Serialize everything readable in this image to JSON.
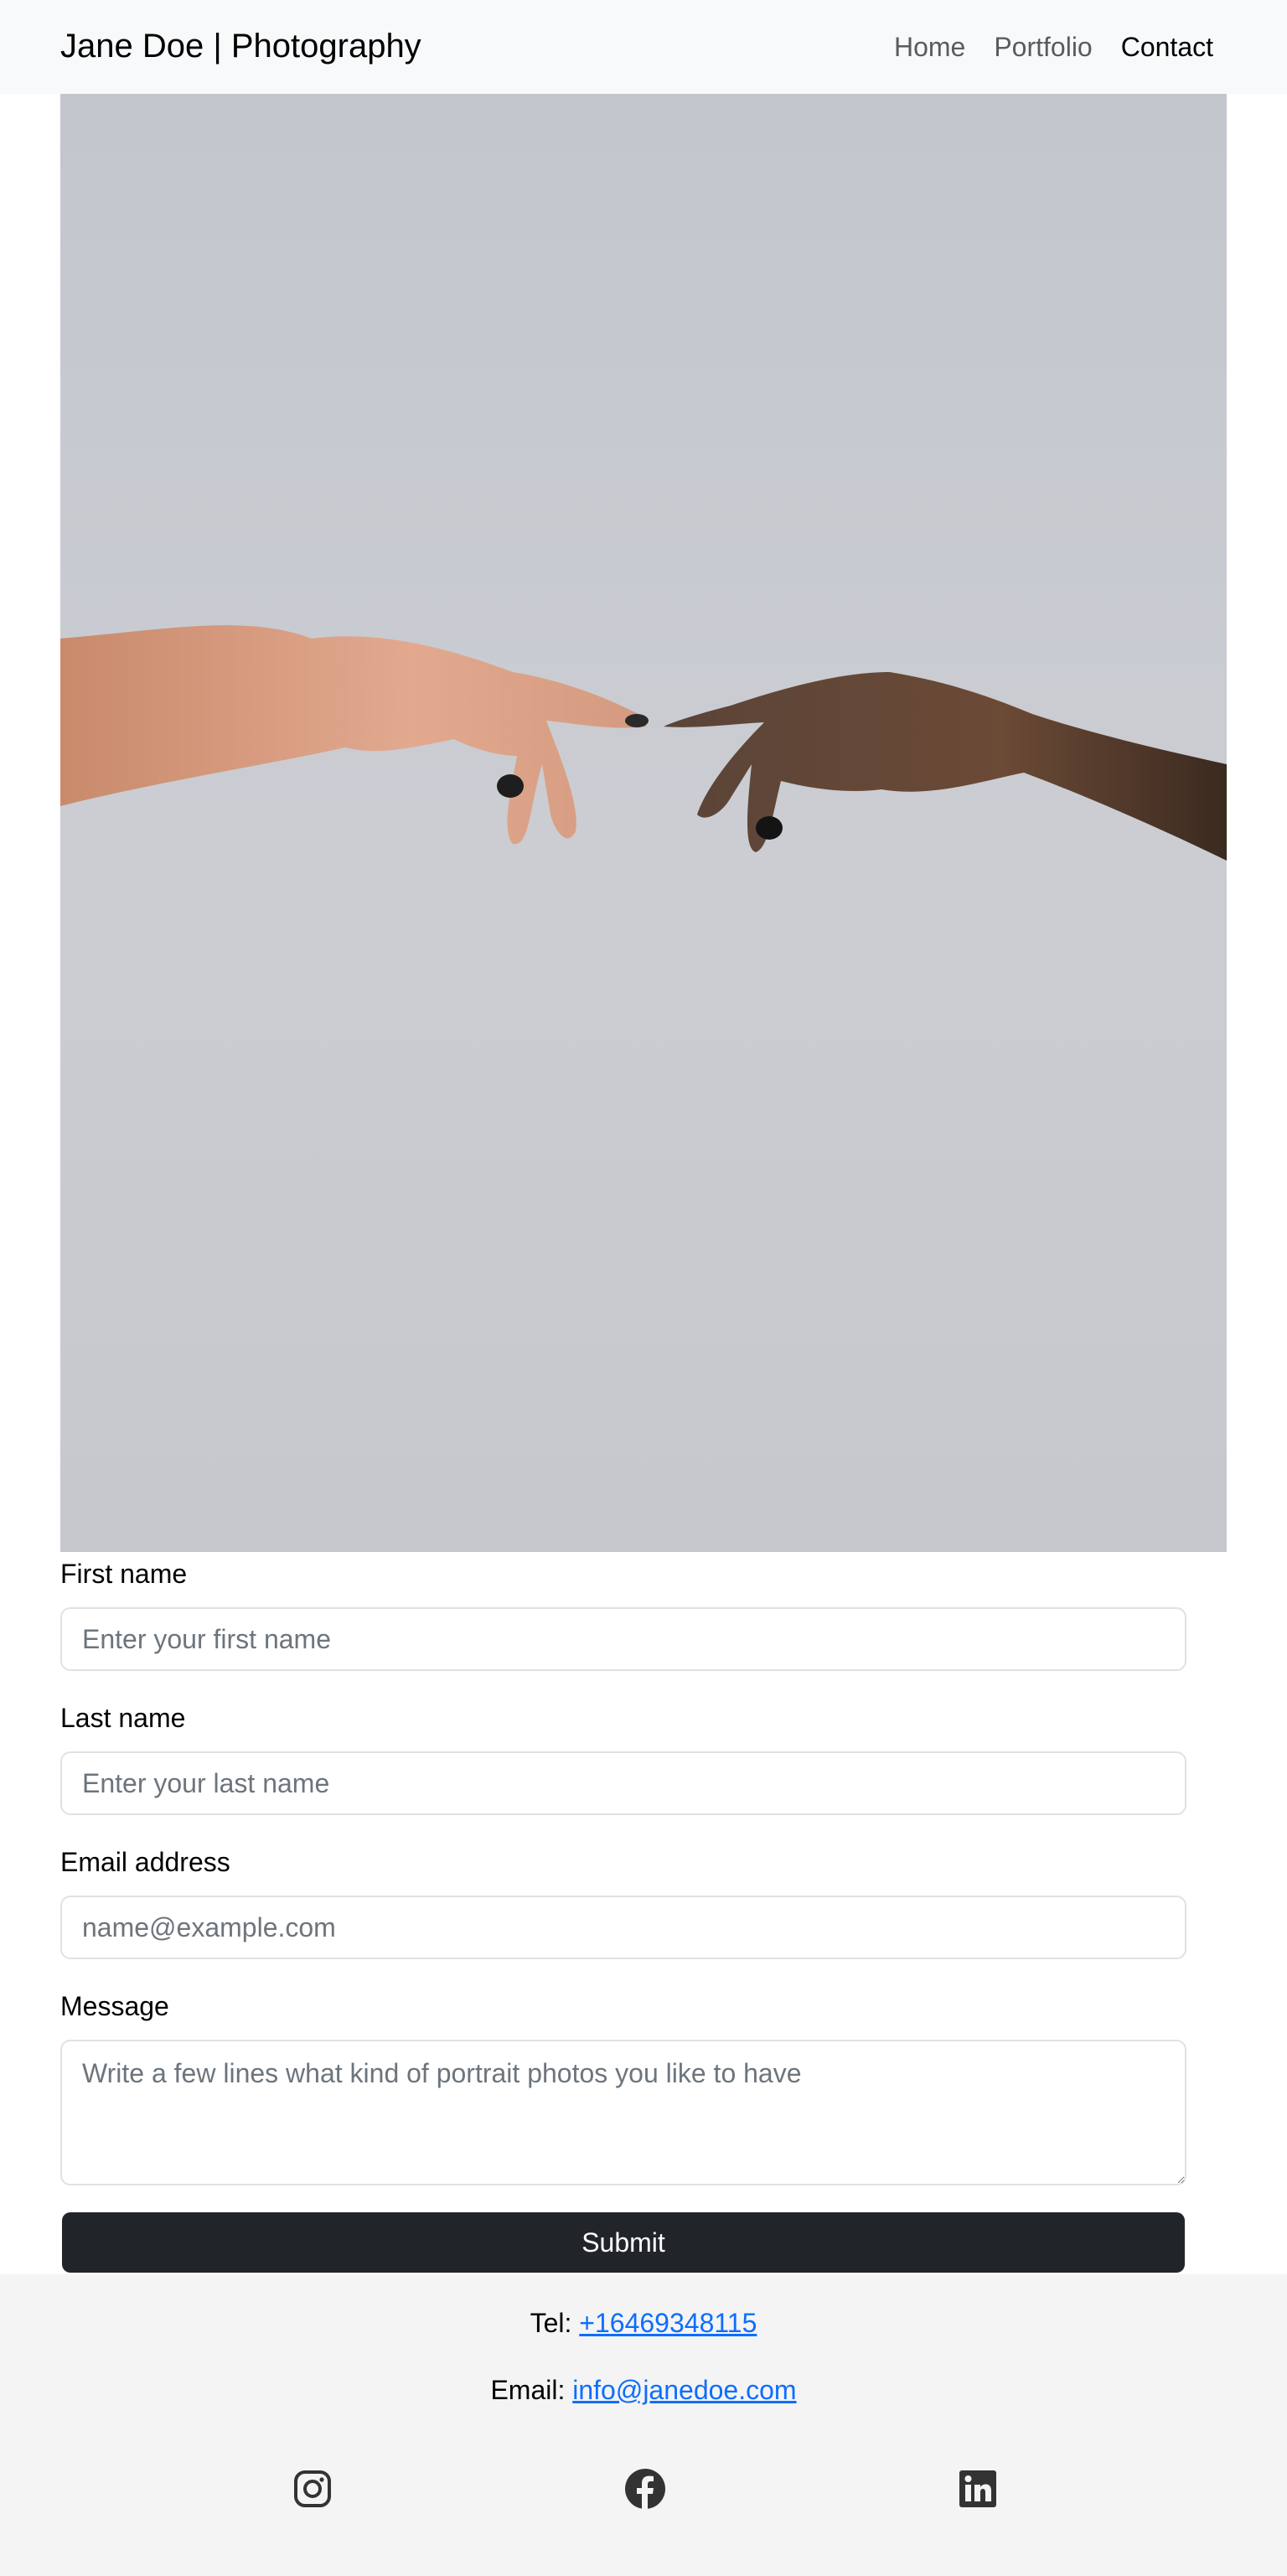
{
  "navbar": {
    "brand": "Jane Doe | Photography",
    "links": [
      {
        "label": "Home",
        "active": false
      },
      {
        "label": "Portfolio",
        "active": false
      },
      {
        "label": "Contact",
        "active": true
      }
    ]
  },
  "hero": {
    "description_icon": "hands-reaching-photo",
    "background_color": "#c7c9ce"
  },
  "form": {
    "first_name": {
      "label": "First name",
      "placeholder": "Enter your first name",
      "value": ""
    },
    "last_name": {
      "label": "Last name",
      "placeholder": "Enter your last name",
      "value": ""
    },
    "email": {
      "label": "Email address",
      "placeholder": "name@example.com",
      "value": ""
    },
    "message": {
      "label": "Message",
      "placeholder": "Write a few lines what kind of portrait photos you like to have",
      "value": ""
    },
    "submit_label": "Submit"
  },
  "footer": {
    "tel_prefix": "Tel: ",
    "tel": "+16469348115",
    "email_prefix": "Email: ",
    "email": "info@janedoe.com",
    "social": [
      {
        "name": "instagram-icon"
      },
      {
        "name": "facebook-icon"
      },
      {
        "name": "linkedin-icon"
      }
    ]
  },
  "colors": {
    "navbar_bg": "#f8f9fa",
    "footer_bg": "#f4f4f4",
    "button_bg": "#212529",
    "link": "#0d6efd"
  }
}
